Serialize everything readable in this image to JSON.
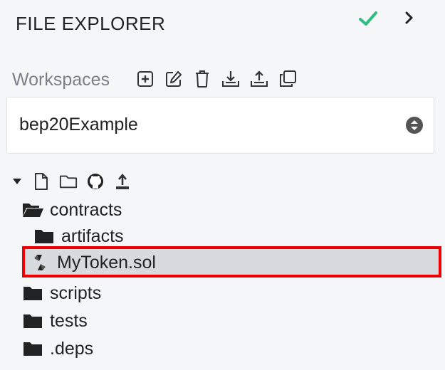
{
  "header": {
    "title": "FILE EXPLORER"
  },
  "workspaces": {
    "label": "Workspaces",
    "selected": "bep20Example",
    "actions": [
      "create-icon",
      "edit-icon",
      "delete-icon",
      "download-icon",
      "upload-icon",
      "clone-icon"
    ]
  },
  "tree": {
    "actions": [
      "expand-toggle-icon",
      "new-file-icon",
      "new-folder-icon",
      "github-icon",
      "upload-icon"
    ],
    "items": [
      {
        "label": "contracts",
        "type": "folder-open"
      },
      {
        "label": "artifacts",
        "type": "folder"
      },
      {
        "label": "MyToken.sol",
        "type": "solidity-file",
        "selected": true
      },
      {
        "label": "scripts",
        "type": "folder"
      },
      {
        "label": "tests",
        "type": "folder"
      },
      {
        "label": ".deps",
        "type": "folder"
      }
    ]
  },
  "colors": {
    "accent_check": "#2ebd7e",
    "highlight_border": "#ee0000",
    "selected_bg": "#d7dbe0"
  }
}
